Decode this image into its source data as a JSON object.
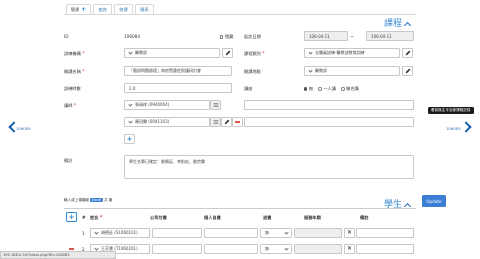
{
  "tabs": [
    {
      "label": "簡課"
    },
    {
      "label": "查詢"
    },
    {
      "label": "修課"
    },
    {
      "label": "簡表"
    }
  ],
  "course": {
    "section_title": "課程",
    "id_label": "ID",
    "id_value": "106084",
    "hidden_label": "隱藏",
    "date_label": "起訖日期",
    "date_start": "106-04-11",
    "date_sep": "~",
    "date_end": "106-04-11",
    "org_label": "訓練機構",
    "org_value": "醫教部",
    "category_label": "課程類別",
    "category_value": "全職員訓練-醫教部教育訓練",
    "topic_label": "開課名稱",
    "topic_value": "「腦部問題處理」病房暨重症照護研討會",
    "venue_label": "開課地點",
    "venue_value": "醫教部",
    "hours_label": "訓練時數",
    "hours_value": "2.0",
    "mode_label": "講座",
    "mode_options": [
      {
        "label": "無",
        "selected": true
      },
      {
        "label": "一人講",
        "selected": false
      },
      {
        "label": "聯合講",
        "selected": false
      }
    ],
    "lecturer_label": "講師",
    "lecturers": [
      {
        "name": "張瑞祥 (0940004)"
      },
      {
        "name": "陳冠霖 (0041103)"
      }
    ],
    "note_label": "備註",
    "note_value": "學生名單已確定：劉姵廷、李柏宏、劉宗霖"
  },
  "nav": {
    "prev_id": "106085",
    "next_id": "106083",
    "next_tooltip": "看前後生平全部課程記錄"
  },
  "students": {
    "section_title": "學生",
    "upload_text_pre": "輸入或上傳檔案",
    "upload_badge": "Excel",
    "upload_text_post": "共 筆",
    "update_button": "Update",
    "columns": [
      "#",
      "姓名",
      "公司付費",
      "個人自費",
      "退費",
      "服務年期",
      "備註"
    ],
    "rows": [
      {
        "index": "1",
        "name": "胡德廷 (S1060101)",
        "refund": "無"
      },
      {
        "index": "2",
        "name": "王芳慧 (T1060201)",
        "refund": "無"
      }
    ]
  },
  "status_bar": {
    "url": "192.168.0.33/?class.php?ID=106083"
  },
  "colors": {
    "accent": "#3a8ad4",
    "nav_arrow": "#1560b0",
    "required": "#d9534f",
    "update_button": "#3a7fd5"
  }
}
